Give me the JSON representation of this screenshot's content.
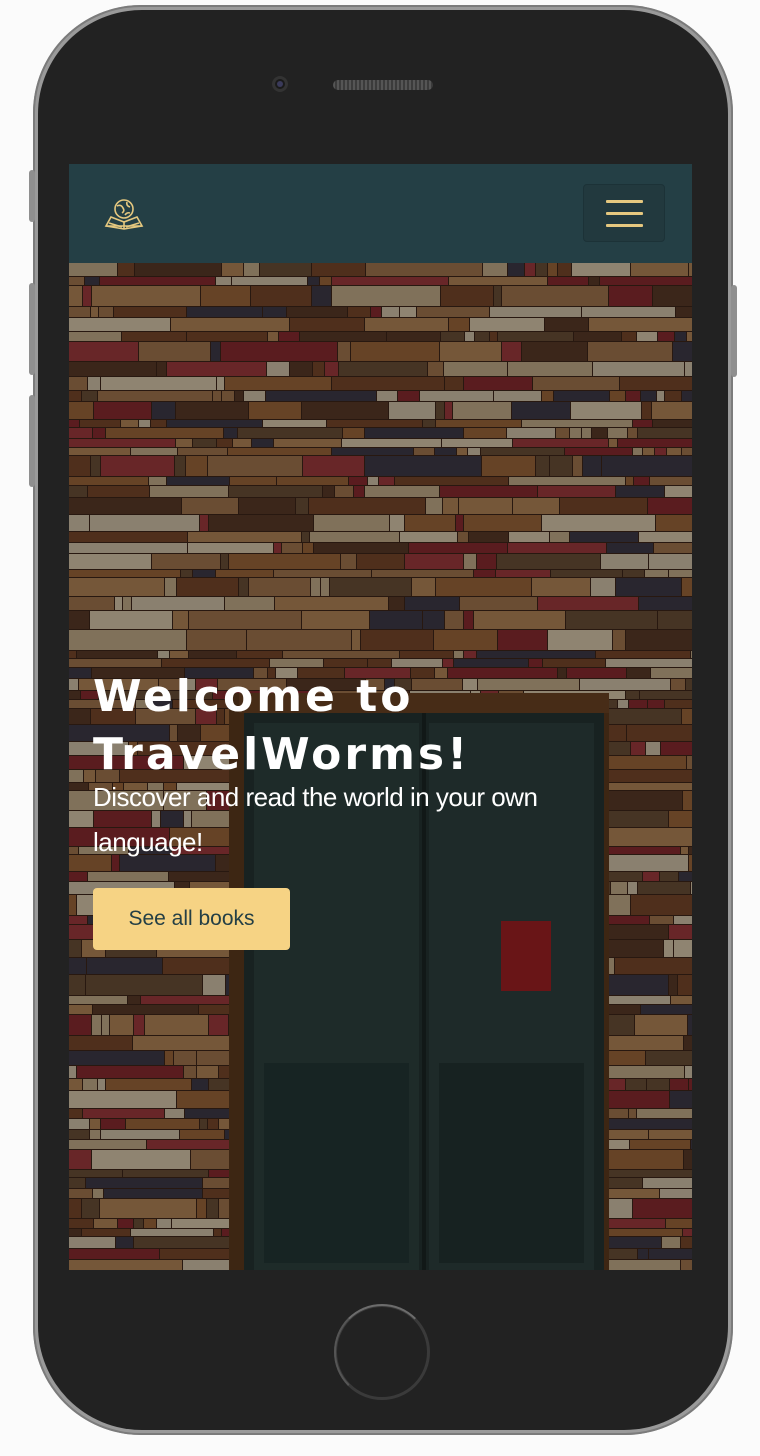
{
  "brand": {
    "logo_icon": "globe-book-icon",
    "accent_color": "#e5c87f"
  },
  "navbar": {
    "background": "#243f45",
    "menu_icon": "hamburger-menu-icon"
  },
  "hero": {
    "background_image": "bookshelves-with-old-door",
    "title": "Welcome to TravelWorms!",
    "subtitle": "Discover and read the world in your own language!",
    "cta_label": "See all books",
    "cta_color": "#f6d384"
  }
}
